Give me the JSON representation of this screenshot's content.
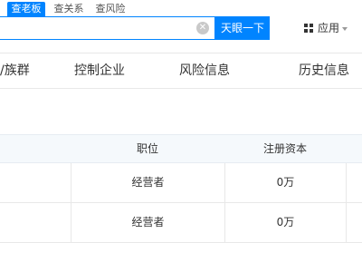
{
  "search_tabs": [
    {
      "label": "查老板",
      "active": true
    },
    {
      "label": "查关系",
      "active": false
    },
    {
      "label": "查风险",
      "active": false
    }
  ],
  "search": {
    "value": "",
    "placeholder": "",
    "clear_icon": "clear-icon",
    "button_label": "天眼一下"
  },
  "app_menu": {
    "icon": "grid-icon",
    "label": "应用"
  },
  "nav": {
    "items": [
      {
        "label": "/族群"
      },
      {
        "label": "控制企业"
      },
      {
        "label": "风险信息"
      },
      {
        "label": "历史信息"
      }
    ]
  },
  "table": {
    "headers": [
      "职位",
      "注册资本"
    ],
    "rows": [
      {
        "position": "经营者",
        "capital": "0万"
      },
      {
        "position": "经营者",
        "capital": "0万"
      }
    ]
  },
  "colors": {
    "accent": "#0084ff"
  }
}
